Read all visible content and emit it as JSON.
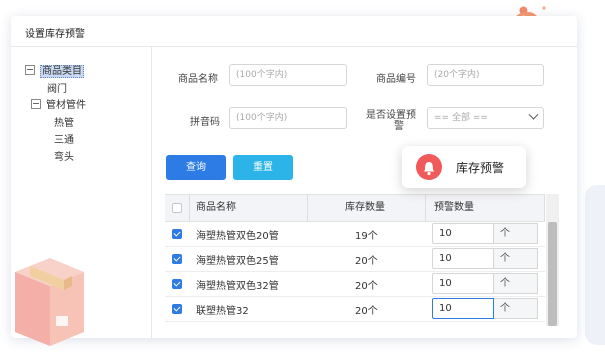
{
  "panel": {
    "title": "设置库存预警"
  },
  "tree": {
    "root": "商品类目",
    "items": [
      "阀门",
      "管材管件",
      "热管",
      "三通",
      "弯头"
    ]
  },
  "form": {
    "name_label": "商品名称",
    "name_placeholder": "(100个字内)",
    "code_label": "商品编号",
    "code_placeholder": "(20个字内)",
    "pinyin_label": "拼音码",
    "pinyin_placeholder": "(100个字内)",
    "alert_label_line1": "是否设置预",
    "alert_label_line2": "警",
    "alert_select_value": "== 全部 =="
  },
  "buttons": {
    "query": "查询",
    "reset": "重置"
  },
  "table": {
    "headers": {
      "name": "商品名称",
      "stock": "库存数量",
      "alert_qty": "预警数量"
    },
    "rows": [
      {
        "name": "海塑热管双色20管",
        "stock": "19个",
        "alert": "10",
        "unit": "个",
        "checked": true
      },
      {
        "name": "海塑热管双色25管",
        "stock": "20个",
        "alert": "10",
        "unit": "个",
        "checked": true
      },
      {
        "name": "海塑热管双色32管",
        "stock": "20个",
        "alert": "10",
        "unit": "个",
        "checked": true
      },
      {
        "name": "联塑热管32",
        "stock": "20个",
        "alert": "10",
        "unit": "个",
        "checked": true
      }
    ]
  },
  "toast": {
    "text": "库存预警",
    "icon": "bell-icon"
  },
  "colors": {
    "primary": "#2d7be5",
    "secondary": "#2cb4e8",
    "alert": "#f05a5a",
    "bell": "#f47c5a",
    "box": "#f3b7b3"
  }
}
